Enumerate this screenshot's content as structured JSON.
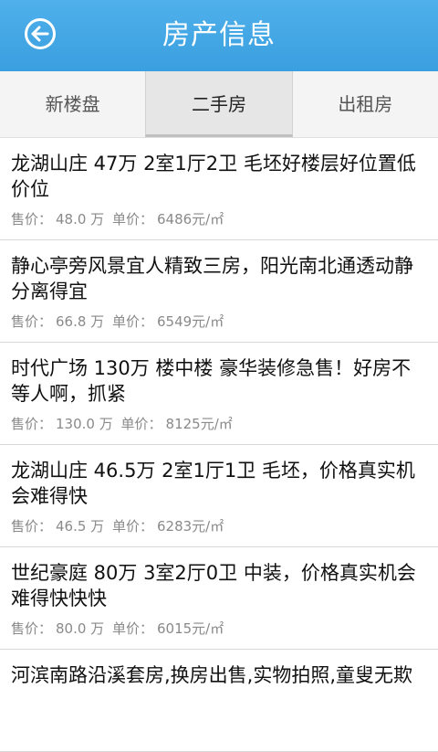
{
  "header": {
    "title": "房产信息"
  },
  "tabs": [
    {
      "label": "新楼盘"
    },
    {
      "label": "二手房"
    },
    {
      "label": "出租房"
    }
  ],
  "items": [
    {
      "title": "龙湖山庄 47万 2室1厅2卫 毛坯好楼层好位置低价位",
      "price_label": "售价：",
      "price": "48.0 万",
      "unit_label": "单价：",
      "unit_price": "6486元/㎡"
    },
    {
      "title": "静心亭旁风景宜人精致三房，阳光南北通透动静分离得宜",
      "price_label": "售价：",
      "price": "66.8 万",
      "unit_label": "单价：",
      "unit_price": "6549元/㎡"
    },
    {
      "title": "时代广场 130万 楼中楼 豪华装修急售！好房不等人啊，抓紧",
      "price_label": "售价：",
      "price": "130.0 万",
      "unit_label": "单价：",
      "unit_price": "8125元/㎡"
    },
    {
      "title": "龙湖山庄 46.5万 2室1厅1卫 毛坯，价格真实机会难得快",
      "price_label": "售价：",
      "price": "46.5 万",
      "unit_label": "单价：",
      "unit_price": "6283元/㎡"
    },
    {
      "title": "世纪豪庭 80万 3室2厅0卫 中装，价格真实机会难得快快快",
      "price_label": "售价：",
      "price": "80.0 万",
      "unit_label": "单价：",
      "unit_price": "6015元/㎡"
    },
    {
      "title": "河滨南路沿溪套房,换房出售,实物拍照,童叟无欺",
      "price_label": "",
      "price": "",
      "unit_label": "",
      "unit_price": ""
    }
  ],
  "colors": {
    "header_bg": "#3a9fe0",
    "active_tab_bg": "#e6e6e6"
  },
  "icons": {
    "back": "back-arrow-circle-icon"
  }
}
